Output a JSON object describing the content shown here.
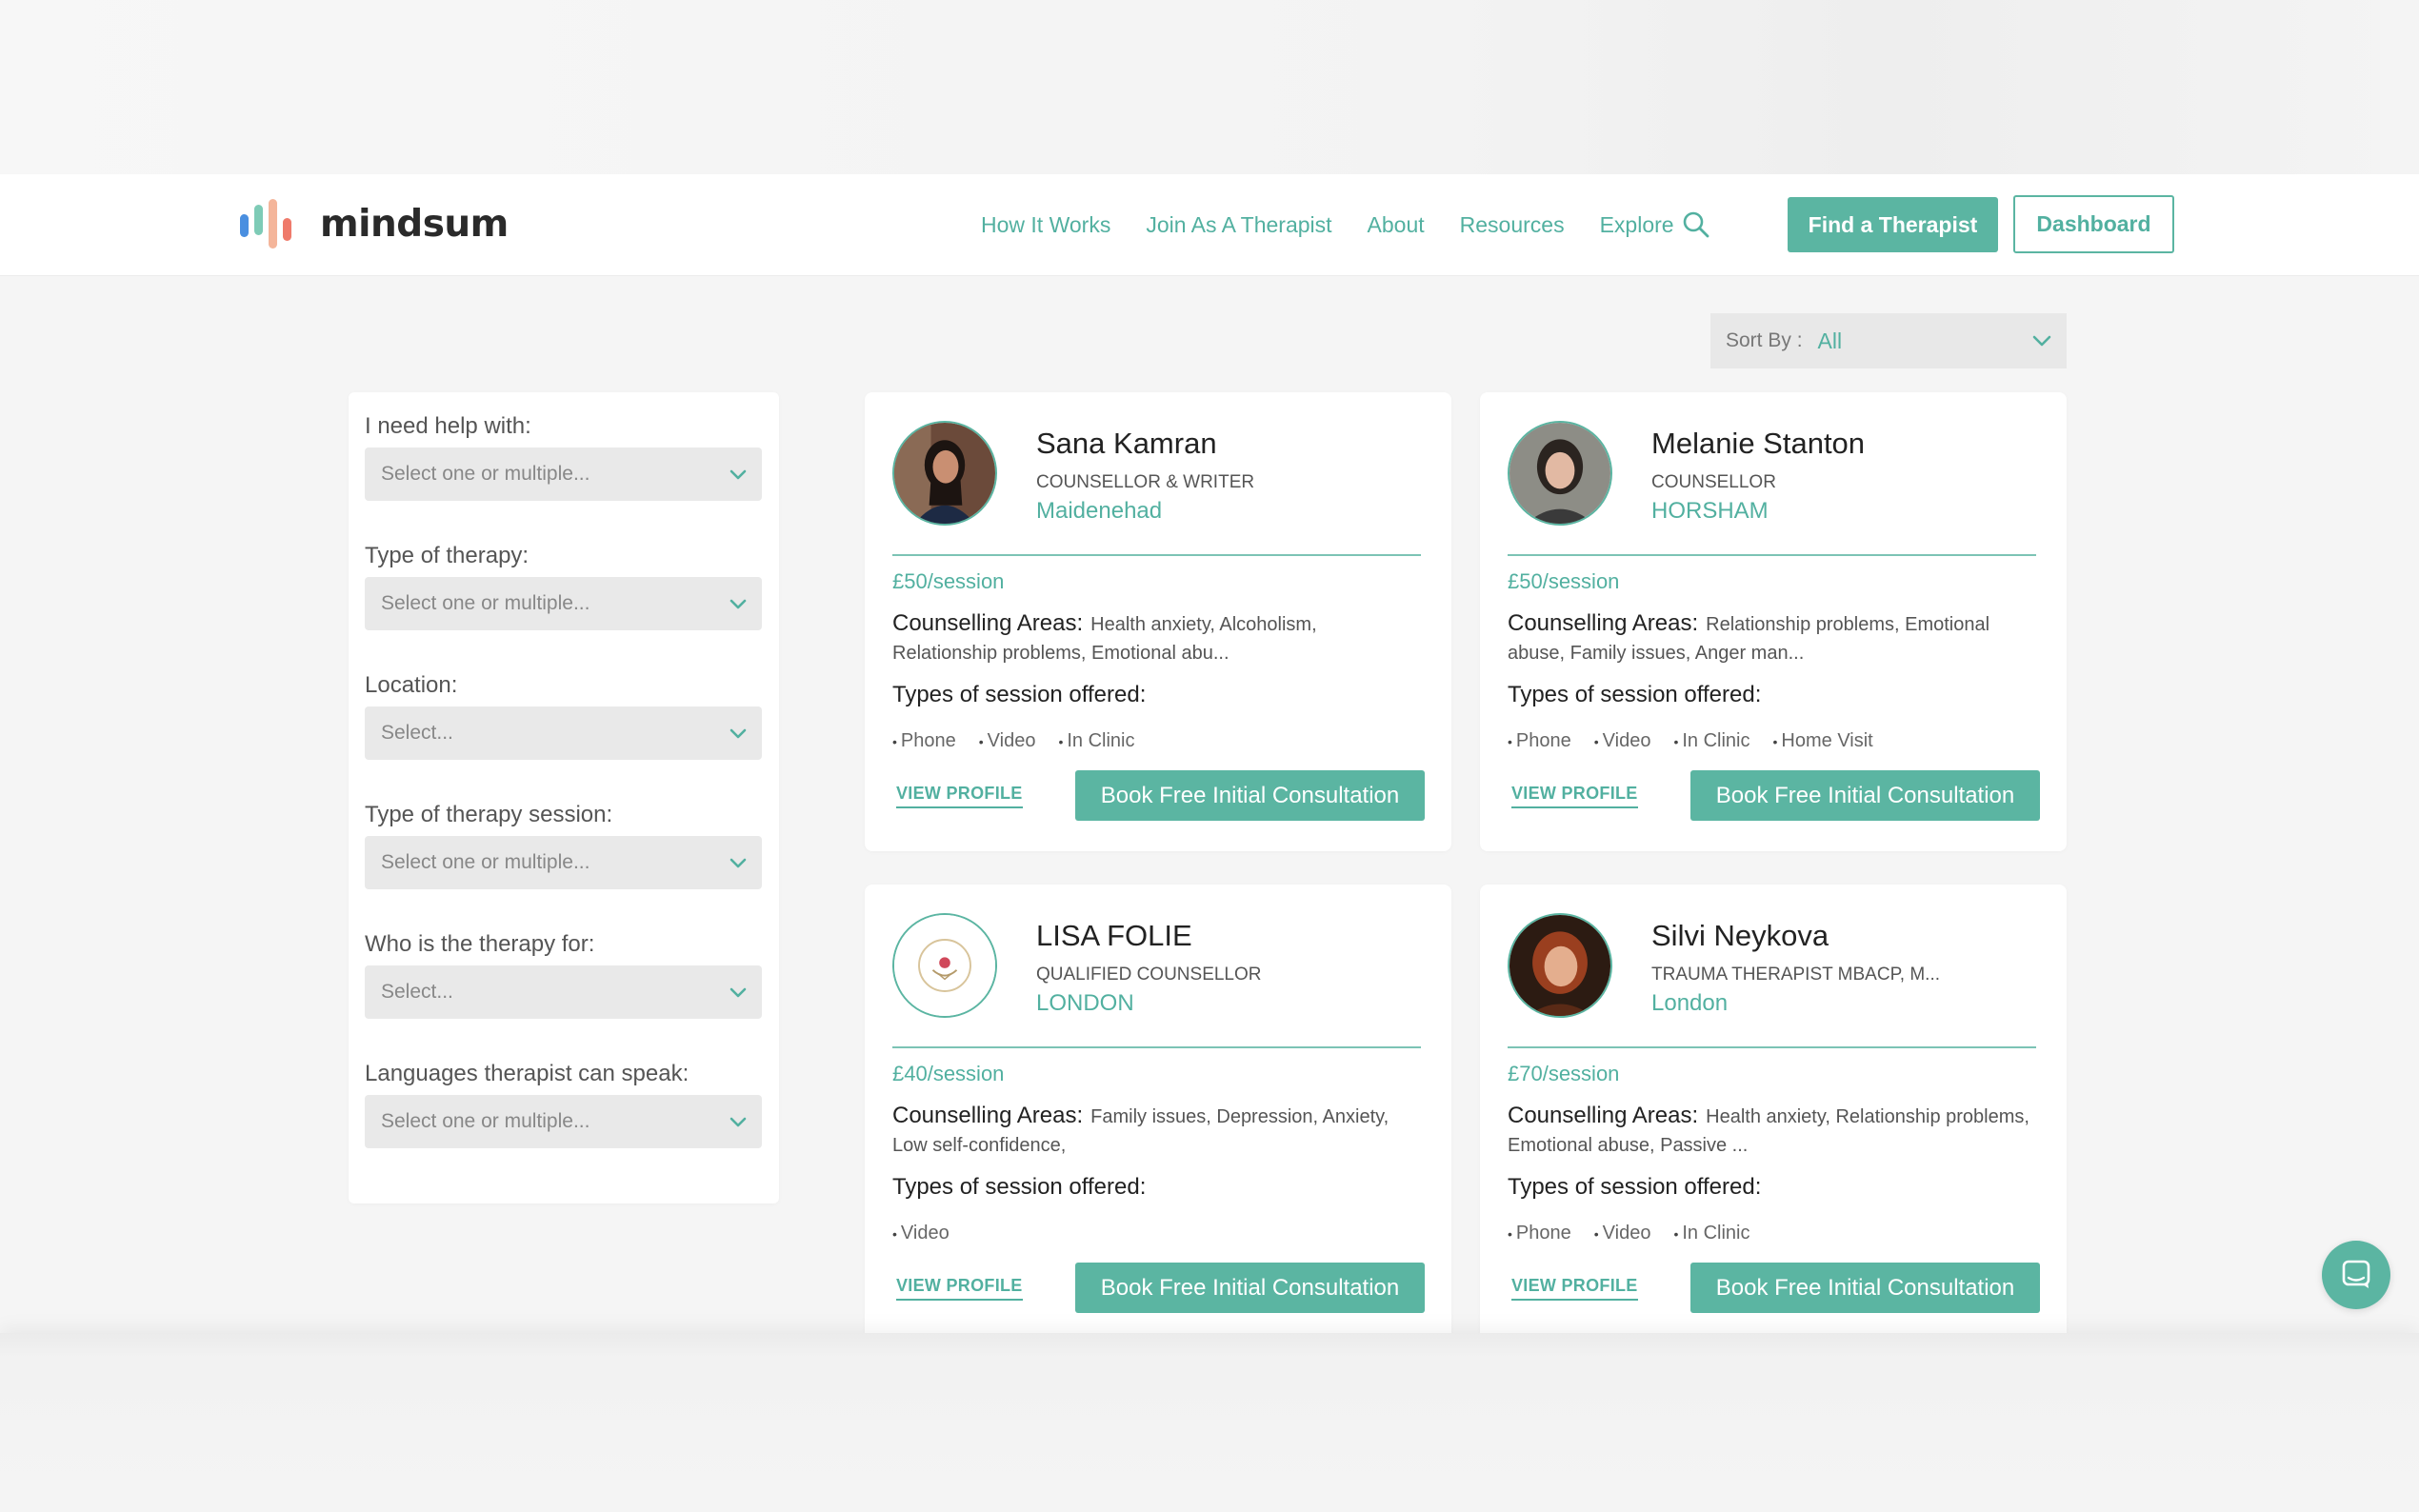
{
  "brand": {
    "name": "mindsum",
    "accent": "#5bb5a2",
    "bar_colors": [
      "#4a8fe0",
      "#7ecbb6",
      "#f4b59a",
      "#ef7a6b"
    ]
  },
  "nav": {
    "links": [
      "How It Works",
      "Join As A Therapist",
      "About",
      "Resources"
    ],
    "explore": "Explore",
    "find_button": "Find a Therapist",
    "dashboard_button": "Dashboard"
  },
  "sort": {
    "label": "Sort By :",
    "value": "All"
  },
  "filters": [
    {
      "label": "I need help with:",
      "placeholder": "Select one or multiple..."
    },
    {
      "label": "Type of therapy:",
      "placeholder": "Select one or multiple..."
    },
    {
      "label": "Location:",
      "placeholder": "Select..."
    },
    {
      "label": "Type of therapy session:",
      "placeholder": "Select one or multiple..."
    },
    {
      "label": "Who is the therapy for:",
      "placeholder": "Select..."
    },
    {
      "label": "Languages therapist can speak:",
      "placeholder": "Select one or multiple..."
    }
  ],
  "card_labels": {
    "areas_label": "Counselling Areas:",
    "types_label": "Types of session offered:",
    "view_profile": "VIEW PROFILE",
    "book": "Book Free Initial Consultation"
  },
  "therapists": [
    {
      "name": "Sana Kamran",
      "title": "COUNSELLOR & WRITER",
      "location": "Maidenehad",
      "price": "£50/session",
      "areas": "Health anxiety, Alcoholism, Relationship problems, Emotional abu...",
      "session_types": [
        "Phone",
        "Video",
        "In Clinic"
      ]
    },
    {
      "name": "Melanie Stanton",
      "title": "COUNSELLOR",
      "location": "HORSHAM",
      "price": "£50/session",
      "areas": "Relationship problems, Emotional abuse, Family issues, Anger man...",
      "session_types": [
        "Phone",
        "Video",
        "In Clinic",
        "Home Visit"
      ]
    },
    {
      "name": "LISA FOLIE",
      "title": "QUALIFIED COUNSELLOR",
      "location": "LONDON",
      "price": "£40/session",
      "areas": "Family issues, Depression, Anxiety, Low self-confidence,",
      "session_types": [
        "Video"
      ]
    },
    {
      "name": "Silvi Neykova",
      "title": "TRAUMA THERAPIST MBACP, M...",
      "location": "London",
      "price": "£70/session",
      "areas": "Health anxiety, Relationship problems, Emotional abuse, Passive ...",
      "session_types": [
        "Phone",
        "Video",
        "In Clinic"
      ]
    }
  ],
  "chat": {
    "icon": "chat-bubble-icon"
  }
}
